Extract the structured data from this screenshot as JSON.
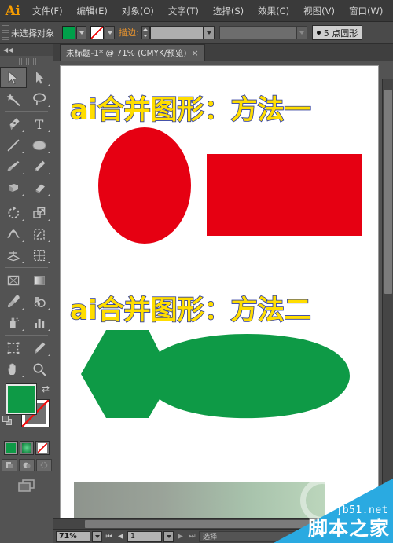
{
  "app": {
    "logo": "Ai",
    "name": "Adobe Illustrator"
  },
  "menubar": {
    "items": [
      {
        "label": "文件(F)",
        "name": "menu-file"
      },
      {
        "label": "编辑(E)",
        "name": "menu-edit"
      },
      {
        "label": "对象(O)",
        "name": "menu-object"
      },
      {
        "label": "文字(T)",
        "name": "menu-type"
      },
      {
        "label": "选择(S)",
        "name": "menu-select"
      },
      {
        "label": "效果(C)",
        "name": "menu-effect"
      },
      {
        "label": "视图(V)",
        "name": "menu-view"
      },
      {
        "label": "窗口(W)",
        "name": "menu-window"
      }
    ]
  },
  "options_bar": {
    "selection_label": "未选择对象",
    "fill_color": "#00a04a",
    "stroke_color": "none",
    "stroke_label": "描边:",
    "stroke_weight_value": "",
    "stroke_weight_placeholder": "",
    "variable_width_value": "",
    "brush_profile": "5 点圆形",
    "brush_profile_bullet": "●"
  },
  "toolbox": {
    "collapse_icon": "◀◀",
    "tools": [
      {
        "name": "selection-tool",
        "label": "选择工具",
        "selected": true
      },
      {
        "name": "direct-selection-tool",
        "label": "直接选择工具",
        "selected": false
      },
      {
        "name": "magic-wand-tool",
        "label": "魔棒工具",
        "selected": false
      },
      {
        "name": "lasso-tool",
        "label": "套索工具",
        "selected": false
      },
      {
        "name": "pen-tool",
        "label": "钢笔工具",
        "selected": false
      },
      {
        "name": "type-tool",
        "label": "文字工具",
        "selected": false
      },
      {
        "name": "line-segment-tool",
        "label": "直线段工具",
        "selected": false
      },
      {
        "name": "ellipse-tool",
        "label": "椭圆工具",
        "selected": false
      },
      {
        "name": "paintbrush-tool",
        "label": "画笔工具",
        "selected": false
      },
      {
        "name": "pencil-tool",
        "label": "铅笔工具",
        "selected": false
      },
      {
        "name": "blob-brush-tool",
        "label": "斑点画笔工具",
        "selected": false
      },
      {
        "name": "eraser-tool",
        "label": "橡皮擦工具",
        "selected": false
      },
      {
        "name": "rotate-tool",
        "label": "旋转工具",
        "selected": false
      },
      {
        "name": "scale-tool",
        "label": "比例缩放工具",
        "selected": false
      },
      {
        "name": "width-tool",
        "label": "宽度工具",
        "selected": false
      },
      {
        "name": "free-transform-tool",
        "label": "自由变换工具",
        "selected": false
      },
      {
        "name": "shape-builder-tool",
        "label": "形状生成器工具",
        "selected": false
      },
      {
        "name": "perspective-grid-tool",
        "label": "透视网格工具",
        "selected": false
      },
      {
        "name": "mesh-tool",
        "label": "网格工具",
        "selected": false
      },
      {
        "name": "gradient-tool",
        "label": "渐变工具",
        "selected": false
      },
      {
        "name": "eyedropper-tool",
        "label": "吸管工具",
        "selected": false
      },
      {
        "name": "blend-tool",
        "label": "混合工具",
        "selected": false
      },
      {
        "name": "symbol-sprayer-tool",
        "label": "符号喷枪工具",
        "selected": false
      },
      {
        "name": "column-graph-tool",
        "label": "柱形图工具",
        "selected": false
      },
      {
        "name": "artboard-tool",
        "label": "画板工具",
        "selected": false
      },
      {
        "name": "slice-tool",
        "label": "切片工具",
        "selected": false
      },
      {
        "name": "hand-tool",
        "label": "抓手工具",
        "selected": false
      },
      {
        "name": "zoom-tool",
        "label": "缩放工具",
        "selected": false
      }
    ],
    "fill_color": "#0e9a46",
    "stroke_color": "none",
    "color_modes": [
      {
        "name": "color-mode-solid",
        "label": "颜色",
        "selected": true
      },
      {
        "name": "color-mode-gradient",
        "label": "渐变",
        "selected": false
      },
      {
        "name": "color-mode-none",
        "label": "无",
        "selected": false
      }
    ],
    "draw_modes": [
      {
        "name": "draw-normal",
        "label": "正常绘图"
      },
      {
        "name": "draw-behind",
        "label": "背面绘图"
      },
      {
        "name": "draw-inside",
        "label": "内部绘图"
      }
    ],
    "screen_mode": "更改屏幕模式"
  },
  "document": {
    "tab_title": "未标题-1* @ 71% (CMYK/预览)",
    "tab_close": "×"
  },
  "artwork": {
    "title_one": "ai合并图形：方法一",
    "title_two": "ai合并图形：方法二",
    "title_fill": "#ffdd00",
    "title_stroke": "#2b3a9e",
    "red_color": "#e60012",
    "green_color": "#0e9a46",
    "shapes": [
      {
        "name": "red-ellipse",
        "type": "ellipse",
        "color": "#e60012"
      },
      {
        "name": "red-rectangle",
        "type": "rect",
        "color": "#e60012"
      },
      {
        "name": "merged-green-shape",
        "type": "compound",
        "color": "#0e9a46"
      },
      {
        "name": "gradient-rectangle",
        "type": "rect",
        "color": "#8e948d → #bcd6bc"
      }
    ]
  },
  "statusbar": {
    "zoom": "71%",
    "page": "1",
    "first_icon": "⏮",
    "prev_icon": "◀",
    "next_icon": "▶",
    "last_icon": "⏭",
    "status_text": "选择"
  },
  "watermark": {
    "en": "jb51.net",
    "cn": "脚本之家",
    "color": "#2aaae1"
  }
}
